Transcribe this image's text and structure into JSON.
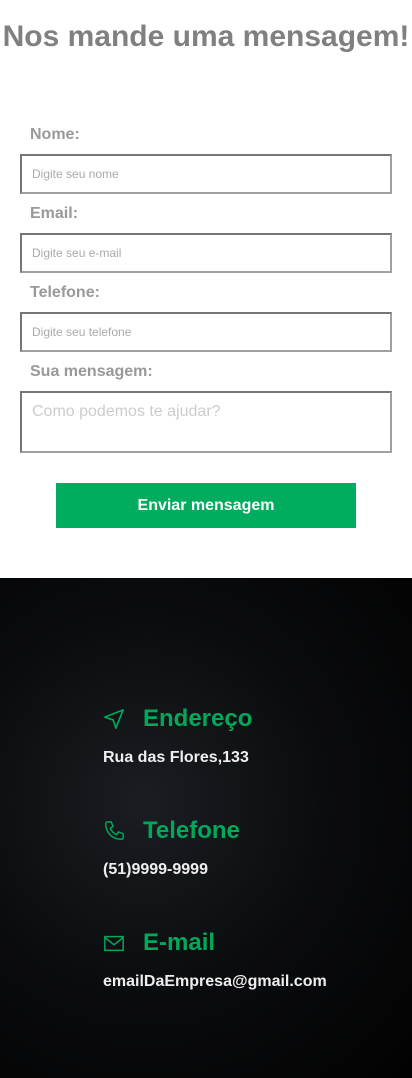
{
  "form": {
    "title": "Nos mande uma mensagem!",
    "fields": [
      {
        "label": "Nome:",
        "placeholder": "Digite seu nome"
      },
      {
        "label": "Email:",
        "placeholder": "Digite seu e-mail"
      },
      {
        "label": "Telefone:",
        "placeholder": "Digite seu telefone"
      },
      {
        "label": "Sua mensagem:",
        "placeholder": "Como podemos te ajudar?"
      }
    ],
    "submit_label": "Enviar mensagem"
  },
  "contact": {
    "items": [
      {
        "title": "Endereço",
        "value": "Rua das Flores,133",
        "icon": "navigation-icon"
      },
      {
        "title": "Telefone",
        "value": "(51)9999-9999",
        "icon": "phone-icon"
      },
      {
        "title": "E-mail",
        "value": "emailDaEmpresa@gmail.com",
        "icon": "mail-icon"
      }
    ],
    "accent": "#00a85a"
  }
}
